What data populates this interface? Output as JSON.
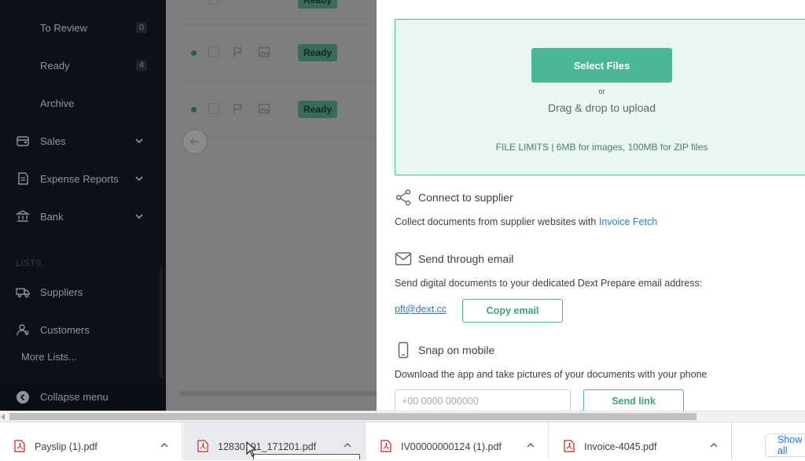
{
  "sidebar": {
    "sub_items": [
      {
        "label": "To Review",
        "count": "0"
      },
      {
        "label": "Ready",
        "count": "4"
      },
      {
        "label": "Archive"
      }
    ],
    "groups": [
      {
        "label": "Sales",
        "icon": "wallet-icon"
      },
      {
        "label": "Expense Reports",
        "icon": "receipt-icon"
      },
      {
        "label": "Bank",
        "icon": "bank-icon"
      }
    ],
    "lists_header": "LISTS",
    "lists": [
      {
        "label": "Suppliers",
        "icon": "truck-icon"
      },
      {
        "label": "Customers",
        "icon": "customers-icon"
      }
    ],
    "more_lists": "More Lists...",
    "collapse": "Collapse menu"
  },
  "background": {
    "rows": [
      {
        "status": "Ready"
      },
      {
        "status": "Ready"
      },
      {
        "status": "Ready"
      }
    ]
  },
  "panel": {
    "upload": {
      "button": "Select Files",
      "or": "or",
      "drag": "Drag & drop to upload",
      "limits": "FILE LIMITS | 6MB for images, 100MB for ZIP files"
    },
    "supplier": {
      "title": "Connect to supplier",
      "desc": "Collect documents from supplier websites with ",
      "link": "Invoice Fetch"
    },
    "email": {
      "title": "Send through email",
      "desc": "Send digital documents to your dedicated Dext Prepare email address:",
      "address": "pft@dext.cc",
      "copy_button": "Copy email"
    },
    "mobile": {
      "title": "Snap on mobile",
      "desc": "Download the app and take pictures of your documents with your phone",
      "placeholder": "+00 0000 000000",
      "send_button": "Send link"
    }
  },
  "downloads": {
    "items": [
      {
        "name": "Payslip (1).pdf"
      },
      {
        "name": "12830191_171201.pdf"
      },
      {
        "name": "IV00000000124 (1).pdf"
      },
      {
        "name": "Invoice-4045.pdf"
      }
    ],
    "show_all": "Show all"
  },
  "colors": {
    "accent": "#4bb596",
    "sidebar_bg": "#0d1018",
    "link": "#2f7cb8"
  }
}
